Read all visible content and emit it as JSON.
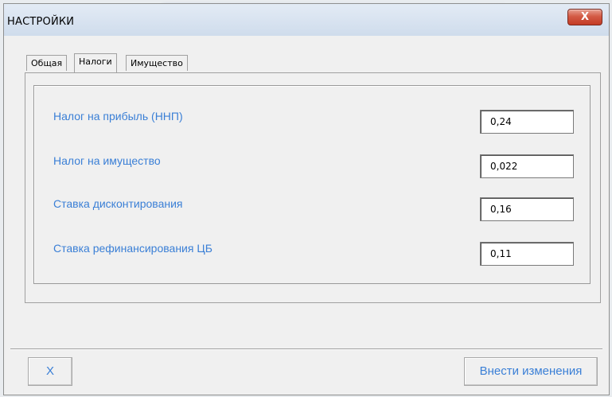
{
  "window": {
    "title": "НАСТРОЙКИ",
    "close_label": "X"
  },
  "tabs": [
    {
      "label": "Общая",
      "active": false
    },
    {
      "label": "Налоги",
      "active": true
    },
    {
      "label": "Имущество",
      "active": false
    }
  ],
  "taxes": {
    "rows": [
      {
        "label": "Налог на прибыль (ННП)",
        "value": "0,24"
      },
      {
        "label": "Налог на имущество",
        "value": "0,022"
      },
      {
        "label": "Ставка дисконтирования",
        "value": "0,16"
      },
      {
        "label": "Ставка рефинансирования ЦБ",
        "value": "0,11"
      }
    ]
  },
  "footer": {
    "cancel_label": "X",
    "apply_label": "Внести изменения"
  },
  "colors": {
    "label_blue": "#3a7fd6",
    "close_red": "#c43b25"
  }
}
